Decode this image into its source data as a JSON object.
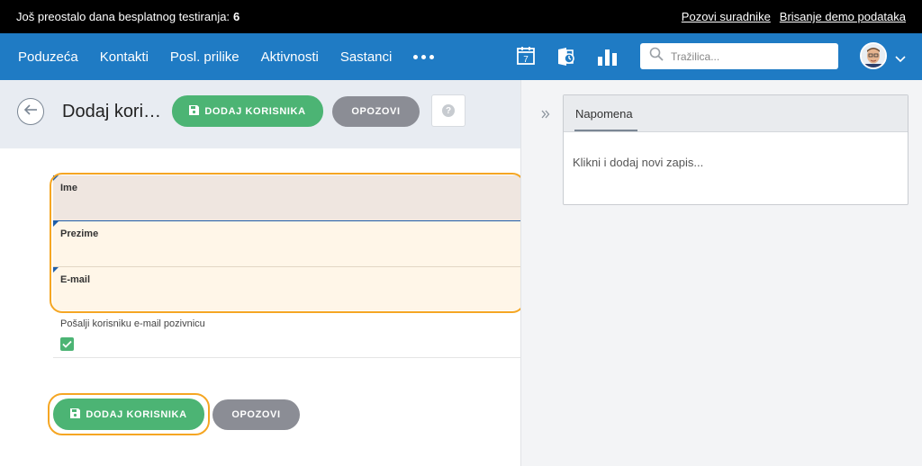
{
  "trial": {
    "text": "Još preostalo dana besplatnog testiranja:",
    "days": "6",
    "invite_link": "Pozovi suradnike",
    "delete_demo_link": "Brisanje demo podataka"
  },
  "nav": {
    "items": [
      {
        "label": "Poduzeća"
      },
      {
        "label": "Kontakti"
      },
      {
        "label": "Posl. prilike"
      },
      {
        "label": "Aktivnosti"
      },
      {
        "label": "Sastanci"
      }
    ],
    "calendar_day": "7",
    "search_placeholder": "Tražilica..."
  },
  "header": {
    "title": "Dodaj kori…",
    "add_button_label": "DODAJ KORISNIKA",
    "cancel_button_label": "OPOZOVI",
    "help_glyph": "?"
  },
  "form": {
    "first_name_label": "Ime",
    "first_name_value": "",
    "last_name_label": "Prezime",
    "last_name_value": "",
    "email_label": "E-mail",
    "email_value": "",
    "invite_label": "Pošalji korisniku e-mail pozivnicu",
    "invite_checked": true
  },
  "footer": {
    "add_button_label": "DODAJ KORISNIKA",
    "cancel_button_label": "OPOZOVI"
  },
  "notes": {
    "tab_label": "Napomena",
    "placeholder": "Klikni i dodaj novi zapis..."
  },
  "colors": {
    "nav": "#1f7bc4",
    "green": "#4cb474",
    "grey_button": "#8b8d95",
    "highlight": "#f5a623"
  }
}
